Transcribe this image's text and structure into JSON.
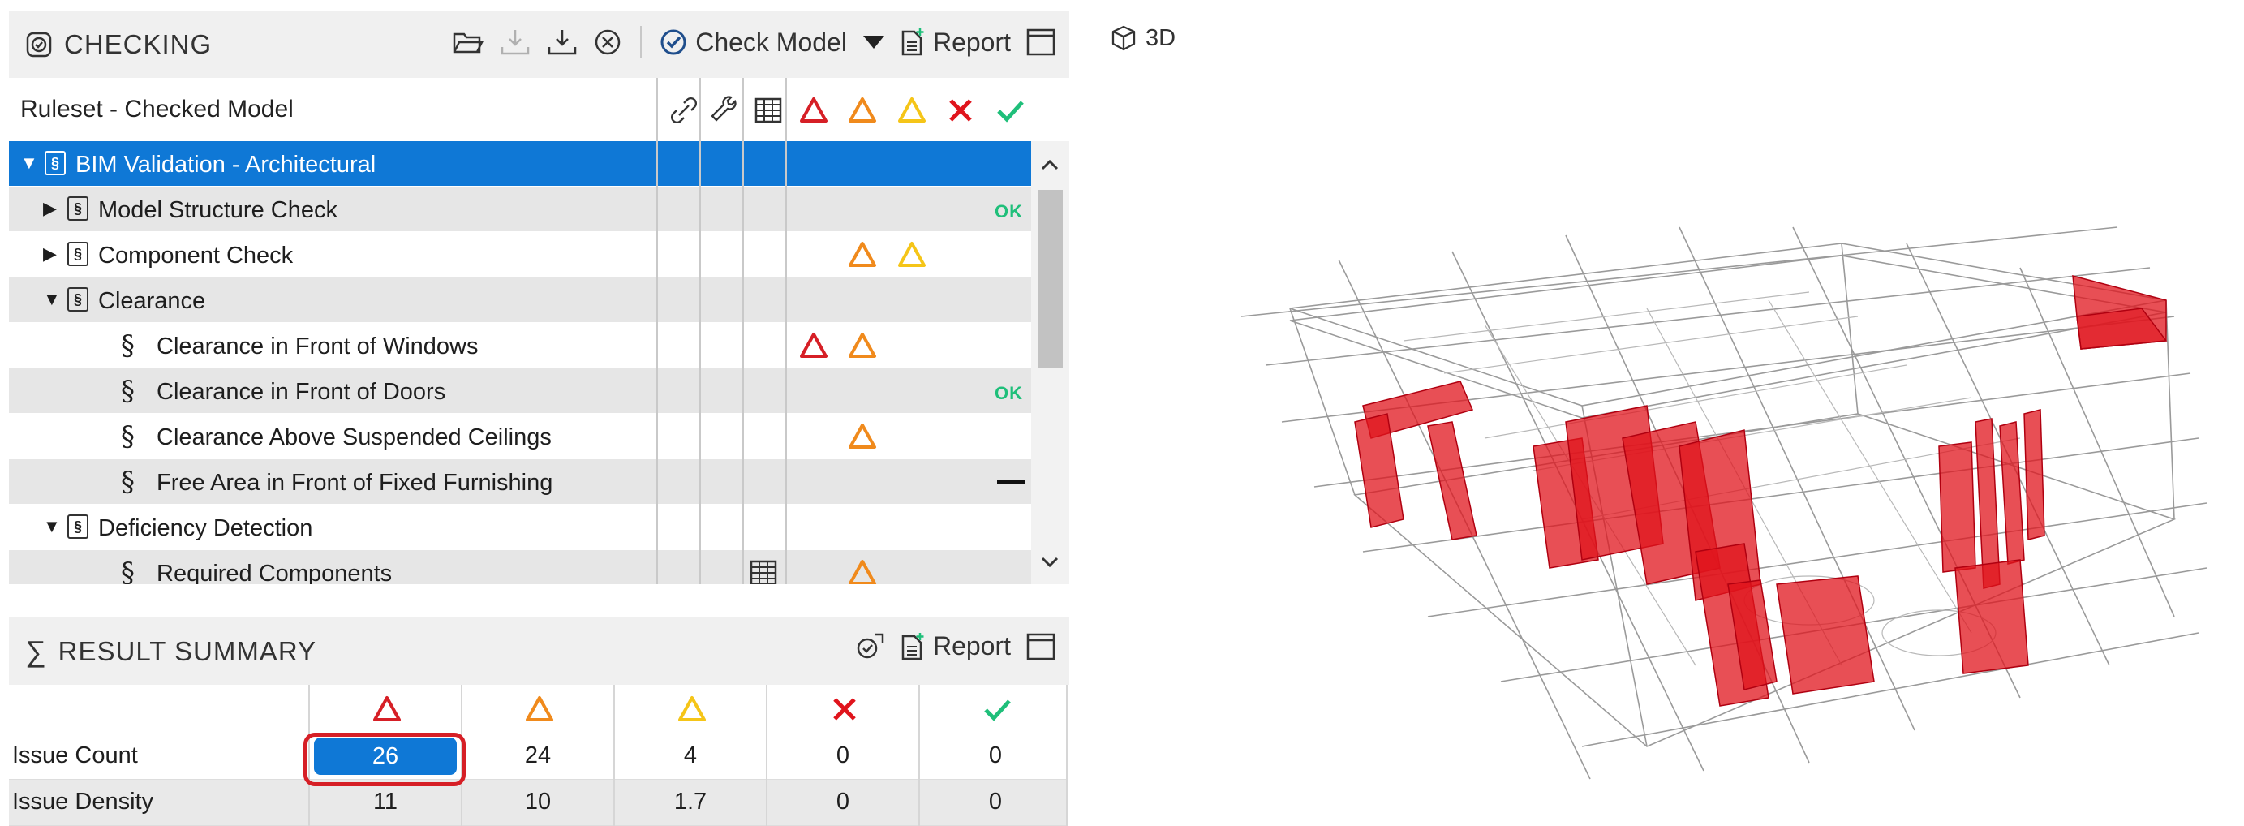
{
  "checking": {
    "title": "CHECKING",
    "check_model_label": "Check Model",
    "report_label": "Report",
    "column_header": "Ruleset - Checked Model",
    "rows": [
      {
        "label": "BIM Validation - Architectural",
        "level": 0,
        "expanded": true,
        "type": "ruleset",
        "selected": true,
        "status": ""
      },
      {
        "label": "Model Structure Check",
        "level": 1,
        "expanded": false,
        "type": "ruleset",
        "status": "OK"
      },
      {
        "label": "Component Check",
        "level": 1,
        "expanded": false,
        "type": "ruleset",
        "status": "medium-low"
      },
      {
        "label": "Clearance",
        "level": 1,
        "expanded": true,
        "type": "ruleset",
        "status": ""
      },
      {
        "label": "Clearance in Front of Windows",
        "level": 2,
        "type": "rule",
        "status": "high-medium"
      },
      {
        "label": "Clearance in Front of Doors",
        "level": 2,
        "type": "rule",
        "status": "OK"
      },
      {
        "label": "Clearance Above Suspended Ceilings",
        "level": 2,
        "type": "rule",
        "status": "medium"
      },
      {
        "label": "Free Area in Front of Fixed Furnishing",
        "level": 2,
        "type": "rule",
        "status": "not-checked"
      },
      {
        "label": "Deficiency Detection",
        "level": 1,
        "expanded": true,
        "type": "ruleset",
        "status": ""
      },
      {
        "label": "Required Components",
        "level": 2,
        "type": "rule",
        "status": "medium",
        "has_table": true
      }
    ],
    "ok_text": "OK"
  },
  "summary": {
    "title": "RESULT SUMMARY",
    "report_label": "Report",
    "rows": [
      {
        "label": "Issue Count",
        "values": [
          "26",
          "24",
          "4",
          "0",
          "0"
        ]
      },
      {
        "label": "Issue Density",
        "values": [
          "11",
          "10",
          "1.7",
          "0",
          "0"
        ]
      }
    ]
  },
  "view3d": {
    "title": "3D"
  },
  "colors": {
    "high": "#d61f26",
    "medium": "#f08a1c",
    "low": "#f5c518",
    "rejected": "#e0141c",
    "approved": "#1fbf7a",
    "selection": "#0f78d6"
  }
}
